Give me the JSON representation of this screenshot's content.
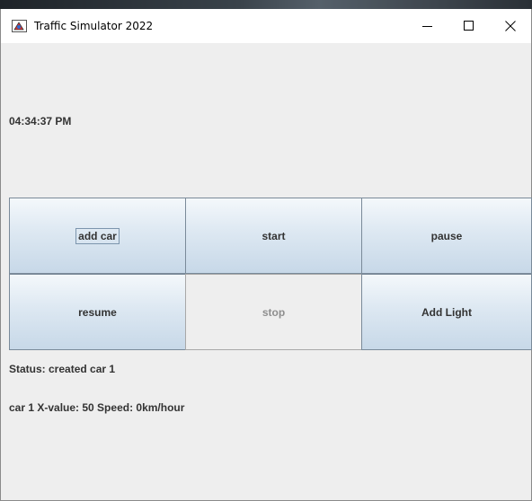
{
  "window": {
    "title": "Traffic Simulator 2022",
    "icon": "java-app-icon",
    "controls": {
      "minimize": "minimize-icon",
      "maximize": "maximize-icon",
      "close": "close-icon"
    }
  },
  "clock": {
    "time": "04:34:37 PM"
  },
  "buttons": {
    "add_car": "add car",
    "start": "start",
    "pause": "pause",
    "resume": "resume",
    "stop": "stop",
    "add_light": "Add Light"
  },
  "status": {
    "text": "Status: created car 1"
  },
  "car_info": {
    "text": "car 1 X-value: 50 Speed: 0km/hour"
  },
  "colors": {
    "button_gradient_top": "#f4f8fb",
    "button_gradient_bottom": "#c7d8e8",
    "button_border": "#7a8a99",
    "panel_background": "#eeeeee",
    "text": "#333333",
    "disabled_text": "#8e8e8e"
  }
}
